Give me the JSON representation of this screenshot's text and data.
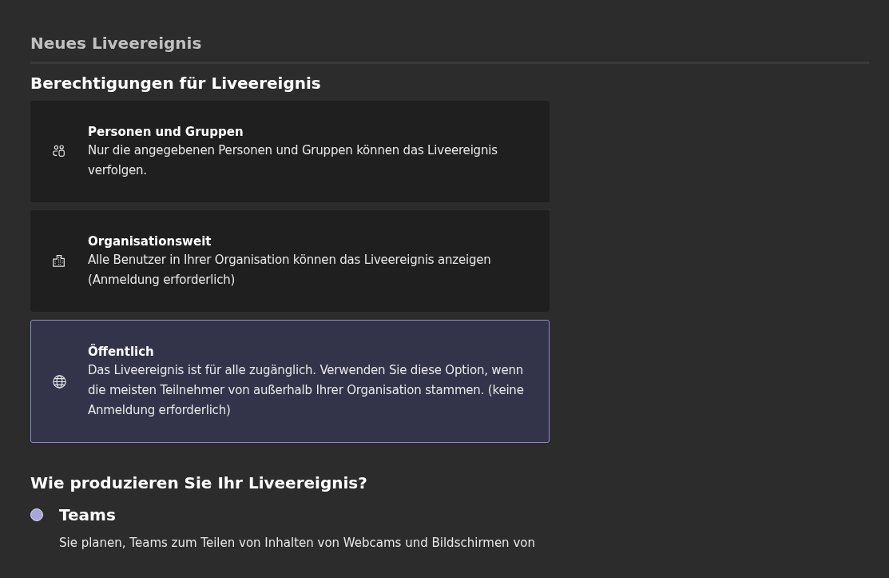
{
  "page_title": "Neues Liveereignis",
  "permissions": {
    "heading": "Berechtigungen für Liveereignis",
    "options": [
      {
        "kind": "people",
        "title": "Personen und Gruppen",
        "description": "Nur die angegebenen Personen und Gruppen können das Liveereignis verfolgen.",
        "selected": false
      },
      {
        "kind": "building",
        "title": "Organisationsweit",
        "description": "Alle Benutzer in Ihrer Organisation können das Liveereignis anzeigen (Anmeldung erforderlich)",
        "selected": false
      },
      {
        "kind": "globe",
        "title": "Öffentlich",
        "description": "Das Liveereignis ist für alle zugänglich. Verwenden Sie diese Option, wenn die meisten Teilnehmer von außerhalb Ihrer Organisation stammen. (keine Anmeldung erforderlich)",
        "selected": true
      }
    ]
  },
  "production": {
    "heading": "Wie produzieren Sie Ihr Liveereignis?",
    "options": [
      {
        "label": "Teams",
        "description": "Sie planen, Teams zum Teilen von Inhalten von Webcams und Bildschirmen von",
        "selected": true
      }
    ]
  }
}
